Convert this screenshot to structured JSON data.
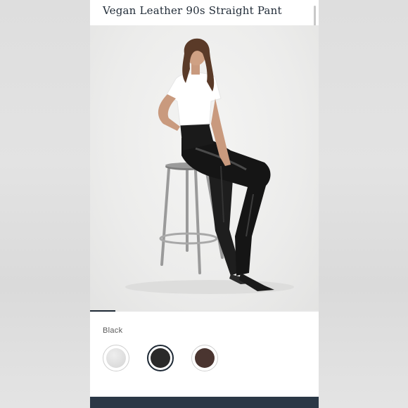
{
  "product": {
    "title": "Vegan Leather 90s Straight Pant"
  },
  "gallery": {
    "progress": 0.11,
    "image_alt": "model-sitting-on-stool-photo"
  },
  "color_selector": {
    "selected_label": "Black",
    "swatches": [
      {
        "name": "light-grey",
        "color": "#d4d4d4",
        "selected": false
      },
      {
        "name": "black",
        "color": "#2a2a2a",
        "selected": true
      },
      {
        "name": "brown",
        "color": "#4a3530",
        "selected": false
      }
    ]
  },
  "colors": {
    "accent": "#1f2a36",
    "bottom_bar": "#2b3846"
  }
}
